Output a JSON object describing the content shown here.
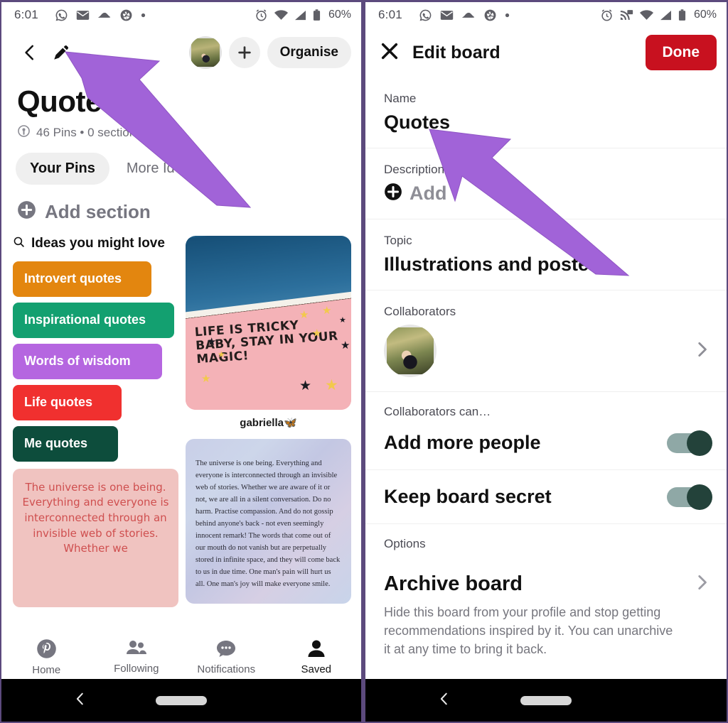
{
  "status_bar": {
    "time": "6:01",
    "battery": "60%",
    "left_icons": [
      "whatsapp-icon",
      "mail-icon",
      "cloud-icon",
      "camera-icon",
      "dot-icon"
    ],
    "right_icons_left": [
      "alarm-icon",
      "wifi-icon",
      "signal-icon",
      "battery-icon"
    ],
    "right_icons_right": [
      "alarm-icon",
      "cast-icon",
      "wifi-icon",
      "signal-icon",
      "battery-icon"
    ]
  },
  "left_screen": {
    "topbar": {
      "back_icon": "back-chevron-icon",
      "edit_icon": "pencil-icon",
      "avatar": "user-avatar",
      "add_icon": "plus-icon",
      "organise_label": "Organise"
    },
    "board": {
      "title": "Quotes",
      "meta": "46 Pins • 0 sections",
      "lock_icon": "lock-icon"
    },
    "tabs": [
      {
        "label": "Your Pins",
        "active": true
      },
      {
        "label": "More Ideas",
        "active": false
      }
    ],
    "add_section_label": "Add section",
    "ideas": {
      "header": "Ideas you might love",
      "search_icon": "search-icon",
      "pills": [
        {
          "label": "Introvert quotes",
          "color": "#E3860F"
        },
        {
          "label": "Inspirational quotes",
          "color": "#13A070"
        },
        {
          "label": "Words of wisdom",
          "color": "#B566E0"
        },
        {
          "label": "Life quotes",
          "color": "#F0302F"
        },
        {
          "label": "Me quotes",
          "color": "#0D4D3C"
        }
      ]
    },
    "pins": {
      "mural": {
        "text": "LIFE IS TRICKY BABY, STAY IN YOUR MAGIC!",
        "caption": "gabriella"
      },
      "universe_serif": "The universe is one being. Everything and everyone is interconnected through an invisible web of stories. Whether we are aware of it or not, we are all in a silent conversation. Do no harm. Practise compassion. And do not gossip behind anyone's back - not even seemingly innocent remark! The words that come out of our mouth do not vanish but are perpetually stored in infinite space, and they will come back to us in due time. One man's pain will hurt us all. One man's joy will make everyone smile.",
      "universe_pink": "The universe is one being. Everything and everyone is interconnected through an invisible web of stories. Whether we"
    },
    "bottom_nav": [
      {
        "label": "Home",
        "icon": "pinterest-icon",
        "active": false
      },
      {
        "label": "Following",
        "icon": "people-icon",
        "active": false
      },
      {
        "label": "Notifications",
        "icon": "chat-bubble-icon",
        "active": false
      },
      {
        "label": "Saved",
        "icon": "person-icon",
        "active": true
      }
    ]
  },
  "right_screen": {
    "topbar": {
      "close_icon": "close-x-icon",
      "title": "Edit board",
      "done_label": "Done"
    },
    "fields": {
      "name_label": "Name",
      "name_value": "Quotes",
      "description_label": "Description",
      "description_add_label": "Add",
      "description_add_icon": "plus-circle-icon",
      "topic_label": "Topic",
      "topic_value": "Illustrations and posters",
      "collaborators_label": "Collaborators",
      "collaborators_chevron": "chevron-right-icon",
      "collaborators_can_label": "Collaborators can…"
    },
    "toggles": [
      {
        "label": "Add more people",
        "on": true
      },
      {
        "label": "Keep board secret",
        "on": true
      }
    ],
    "options": {
      "section_label": "Options",
      "archive_title": "Archive board",
      "archive_chevron": "chevron-right-icon",
      "archive_desc": "Hide this board from your profile and stop getting recommendations inspired by it. You can unarchive it at any time to bring it back."
    }
  },
  "android_nav": {
    "back_icon": "back-chevron-icon",
    "home_pill": "home-pill-icon"
  },
  "annotations": {
    "arrow_color": "#A163D8",
    "arrows": [
      "arrow-pointing-to-pencil-icon",
      "arrow-pointing-to-name-field"
    ]
  }
}
